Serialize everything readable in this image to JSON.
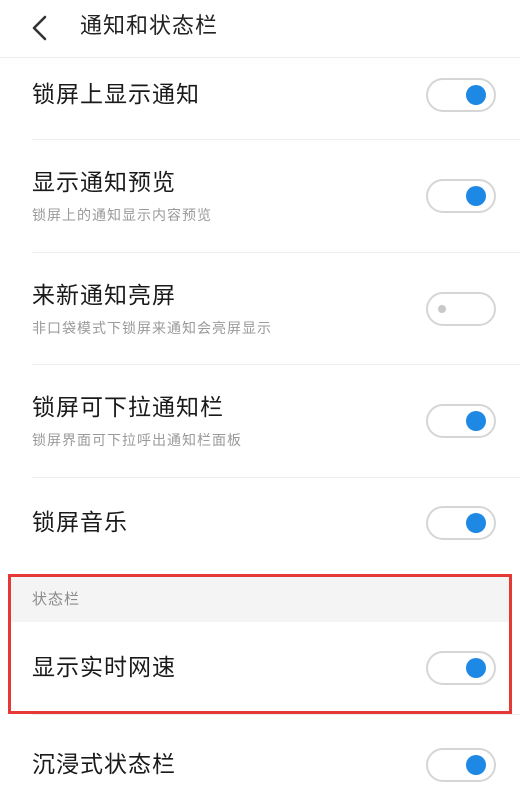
{
  "header": {
    "title": "通知和状态栏",
    "back_icon": "chevron-left-icon"
  },
  "settings": [
    {
      "title": "锁屏上显示通知",
      "subtitle": "",
      "enabled": true
    },
    {
      "title": "显示通知预览",
      "subtitle": "锁屏上的通知显示内容预览",
      "enabled": true
    },
    {
      "title": "来新通知亮屏",
      "subtitle": "非口袋模式下锁屏来通知会亮屏显示",
      "enabled": false
    },
    {
      "title": "锁屏可下拉通知栏",
      "subtitle": "锁屏界面可下拉呼出通知栏面板",
      "enabled": true
    },
    {
      "title": "锁屏音乐",
      "subtitle": "",
      "enabled": true
    }
  ],
  "status_bar_section": {
    "label": "状态栏",
    "items": [
      {
        "title": "显示实时网速",
        "enabled": true
      },
      {
        "title": "沉浸式状态栏",
        "enabled": true
      }
    ]
  },
  "colors": {
    "toggle_on": "#1e88e5",
    "toggle_off_knob": "#c8c8c8",
    "highlight_box": "#e53935",
    "section_background": "#f4f4f4"
  }
}
